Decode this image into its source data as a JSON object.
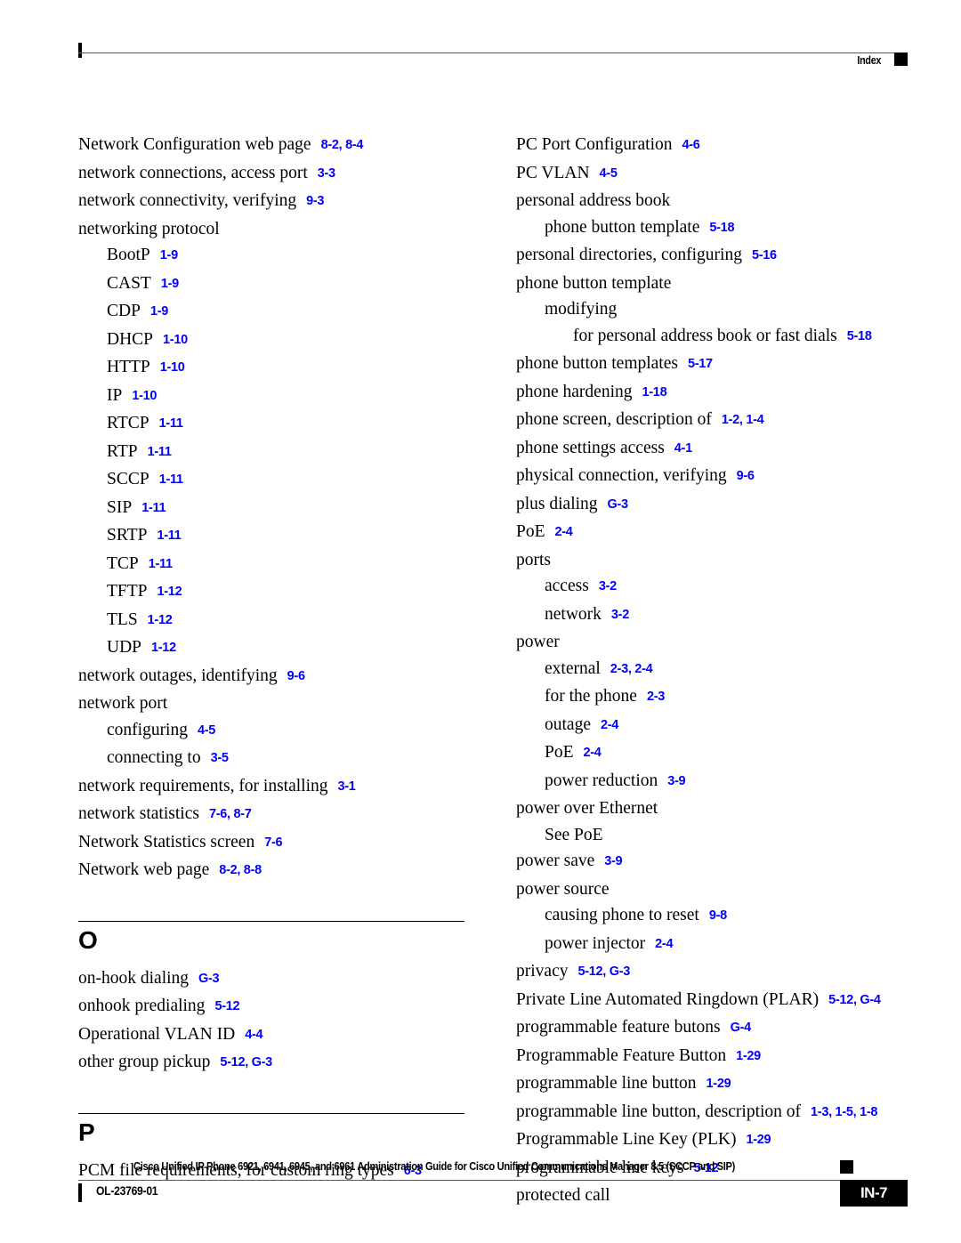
{
  "header": {
    "label": "Index"
  },
  "colors": {
    "page_reference": "#0000ff",
    "text": "#000000",
    "rule": "#58585a"
  },
  "columns": {
    "left": [
      {
        "kind": "entry",
        "level": 0,
        "term": "Network Configuration web page",
        "refs": "8-2, 8-4"
      },
      {
        "kind": "entry",
        "level": 0,
        "term": "network connections, access port",
        "refs": "3-3"
      },
      {
        "kind": "entry",
        "level": 0,
        "term": "network connectivity, verifying",
        "refs": "9-3"
      },
      {
        "kind": "entry",
        "level": 0,
        "term": "networking protocol",
        "refs": ""
      },
      {
        "kind": "entry",
        "level": 1,
        "term": "BootP",
        "refs": "1-9"
      },
      {
        "kind": "entry",
        "level": 1,
        "term": "CAST",
        "refs": "1-9"
      },
      {
        "kind": "entry",
        "level": 1,
        "term": "CDP",
        "refs": "1-9"
      },
      {
        "kind": "entry",
        "level": 1,
        "term": "DHCP",
        "refs": "1-10"
      },
      {
        "kind": "entry",
        "level": 1,
        "term": "HTTP",
        "refs": "1-10"
      },
      {
        "kind": "entry",
        "level": 1,
        "term": "IP",
        "refs": "1-10"
      },
      {
        "kind": "entry",
        "level": 1,
        "term": "RTCP",
        "refs": "1-11"
      },
      {
        "kind": "entry",
        "level": 1,
        "term": "RTP",
        "refs": "1-11"
      },
      {
        "kind": "entry",
        "level": 1,
        "term": "SCCP",
        "refs": "1-11"
      },
      {
        "kind": "entry",
        "level": 1,
        "term": "SIP",
        "refs": "1-11"
      },
      {
        "kind": "entry",
        "level": 1,
        "term": "SRTP",
        "refs": "1-11"
      },
      {
        "kind": "entry",
        "level": 1,
        "term": "TCP",
        "refs": "1-11"
      },
      {
        "kind": "entry",
        "level": 1,
        "term": "TFTP",
        "refs": "1-12"
      },
      {
        "kind": "entry",
        "level": 1,
        "term": "TLS",
        "refs": "1-12"
      },
      {
        "kind": "entry",
        "level": 1,
        "term": "UDP",
        "refs": "1-12"
      },
      {
        "kind": "entry",
        "level": 0,
        "term": "network outages, identifying",
        "refs": "9-6"
      },
      {
        "kind": "entry",
        "level": 0,
        "term": "network port",
        "refs": ""
      },
      {
        "kind": "entry",
        "level": 1,
        "term": "configuring",
        "refs": "4-5"
      },
      {
        "kind": "entry",
        "level": 1,
        "term": "connecting to",
        "refs": "3-5"
      },
      {
        "kind": "entry",
        "level": 0,
        "term": "network requirements, for installing",
        "refs": "3-1"
      },
      {
        "kind": "entry",
        "level": 0,
        "term": "network statistics",
        "refs": "7-6, 8-7"
      },
      {
        "kind": "entry",
        "level": 0,
        "term": "Network Statistics screen",
        "refs": "7-6"
      },
      {
        "kind": "entry",
        "level": 0,
        "term": "Network web page",
        "refs": "8-2, 8-8"
      },
      {
        "kind": "gap"
      },
      {
        "kind": "section",
        "letter": "O"
      },
      {
        "kind": "entry",
        "level": 0,
        "term": "on-hook dialing",
        "refs": "G-3"
      },
      {
        "kind": "entry",
        "level": 0,
        "term": "onhook predialing",
        "refs": "5-12"
      },
      {
        "kind": "entry",
        "level": 0,
        "term": "Operational VLAN ID",
        "refs": "4-4"
      },
      {
        "kind": "entry",
        "level": 0,
        "term": "other group pickup",
        "refs": "5-12, G-3"
      },
      {
        "kind": "gap"
      },
      {
        "kind": "section",
        "letter": "P"
      },
      {
        "kind": "entry",
        "level": 0,
        "term": "PCM file requirements, for custom ring types",
        "refs": "6-3"
      }
    ],
    "right": [
      {
        "kind": "entry",
        "level": 0,
        "term": "PC Port Configuration",
        "refs": "4-6"
      },
      {
        "kind": "entry",
        "level": 0,
        "term": "PC VLAN",
        "refs": "4-5"
      },
      {
        "kind": "entry",
        "level": 0,
        "term": "personal address book",
        "refs": ""
      },
      {
        "kind": "entry",
        "level": 1,
        "term": "phone button template",
        "refs": "5-18"
      },
      {
        "kind": "entry",
        "level": 0,
        "term": "personal directories, configuring",
        "refs": "5-16"
      },
      {
        "kind": "entry",
        "level": 0,
        "term": "phone button template",
        "refs": ""
      },
      {
        "kind": "entry",
        "level": 1,
        "term": "modifying",
        "refs": ""
      },
      {
        "kind": "entry",
        "level": 2,
        "term": "for personal address book or fast dials",
        "refs": "5-18"
      },
      {
        "kind": "entry",
        "level": 0,
        "term": "phone button templates",
        "refs": "5-17"
      },
      {
        "kind": "entry",
        "level": 0,
        "term": "phone hardening",
        "refs": "1-18"
      },
      {
        "kind": "entry",
        "level": 0,
        "term": "phone screen, description of",
        "refs": "1-2, 1-4"
      },
      {
        "kind": "entry",
        "level": 0,
        "term": "phone settings access",
        "refs": "4-1"
      },
      {
        "kind": "entry",
        "level": 0,
        "term": "physical connection, verifying",
        "refs": "9-6"
      },
      {
        "kind": "entry",
        "level": 0,
        "term": "plus dialing",
        "refs": "G-3"
      },
      {
        "kind": "entry",
        "level": 0,
        "term": "PoE",
        "refs": "2-4"
      },
      {
        "kind": "entry",
        "level": 0,
        "term": "ports",
        "refs": ""
      },
      {
        "kind": "entry",
        "level": 1,
        "term": "access",
        "refs": "3-2"
      },
      {
        "kind": "entry",
        "level": 1,
        "term": "network",
        "refs": "3-2"
      },
      {
        "kind": "entry",
        "level": 0,
        "term": "power",
        "refs": ""
      },
      {
        "kind": "entry",
        "level": 1,
        "term": "external",
        "refs": "2-3, 2-4"
      },
      {
        "kind": "entry",
        "level": 1,
        "term": "for the phone",
        "refs": "2-3"
      },
      {
        "kind": "entry",
        "level": 1,
        "term": "outage",
        "refs": "2-4"
      },
      {
        "kind": "entry",
        "level": 1,
        "term": "PoE",
        "refs": "2-4"
      },
      {
        "kind": "entry",
        "level": 1,
        "term": "power reduction",
        "refs": "3-9"
      },
      {
        "kind": "entry",
        "level": 0,
        "term": "power over Ethernet",
        "refs": ""
      },
      {
        "kind": "entry",
        "level": 1,
        "term": "See PoE",
        "refs": ""
      },
      {
        "kind": "entry",
        "level": 0,
        "term": "power save",
        "refs": "3-9"
      },
      {
        "kind": "entry",
        "level": 0,
        "term": "power source",
        "refs": ""
      },
      {
        "kind": "entry",
        "level": 1,
        "term": "causing phone to reset",
        "refs": "9-8"
      },
      {
        "kind": "entry",
        "level": 1,
        "term": "power injector",
        "refs": "2-4"
      },
      {
        "kind": "entry",
        "level": 0,
        "term": "privacy",
        "refs": "5-12, G-3"
      },
      {
        "kind": "entry",
        "level": 0,
        "term": "Private Line Automated Ringdown (PLAR)",
        "refs": "5-12, G-4"
      },
      {
        "kind": "entry",
        "level": 0,
        "term": "programmable feature butons",
        "refs": "G-4"
      },
      {
        "kind": "entry",
        "level": 0,
        "term": "Programmable Feature Button",
        "refs": "1-29"
      },
      {
        "kind": "entry",
        "level": 0,
        "term": "programmable line button",
        "refs": "1-29"
      },
      {
        "kind": "entry",
        "level": 0,
        "term": "programmable line button, description of",
        "refs": "1-3, 1-5, 1-8"
      },
      {
        "kind": "entry",
        "level": 0,
        "term": "Programmable Line Key (PLK)",
        "refs": "1-29"
      },
      {
        "kind": "entry",
        "level": 0,
        "term": "programmable line keys",
        "refs": "5-12"
      },
      {
        "kind": "entry",
        "level": 0,
        "term": "protected call",
        "refs": ""
      }
    ]
  },
  "footer": {
    "title": "Cisco Unified IP Phone 6921, 6941, 6945, and 6961 Administration Guide for Cisco Unified Communications Manager 8.5 (SCCP and SIP)",
    "doc_id": "OL-23769-01",
    "page_number": "IN-7"
  }
}
